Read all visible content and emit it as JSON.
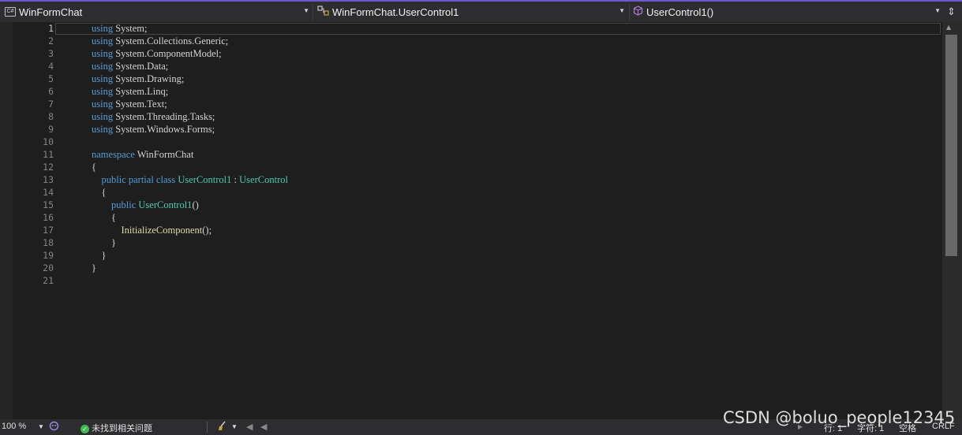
{
  "navbar": {
    "project_label": "WinFormChat",
    "type_label": "WinFormChat.UserControl1",
    "member_label": "UserControl1()"
  },
  "icons": {
    "project": "csharp-project-icon",
    "type": "class-icon",
    "member": "method-cube-icon",
    "split": "split-window-icon"
  },
  "code_lines": [
    {
      "n": "1",
      "tokens": [
        {
          "t": "using",
          "c": "kw"
        },
        {
          "t": " System;",
          "c": "pl"
        }
      ]
    },
    {
      "n": "2",
      "tokens": [
        {
          "t": "using",
          "c": "kw"
        },
        {
          "t": " System.Collections.Generic;",
          "c": "pl"
        }
      ]
    },
    {
      "n": "3",
      "tokens": [
        {
          "t": "using",
          "c": "kw"
        },
        {
          "t": " System.ComponentModel;",
          "c": "pl"
        }
      ]
    },
    {
      "n": "4",
      "tokens": [
        {
          "t": "using",
          "c": "kw"
        },
        {
          "t": " System.Data;",
          "c": "pl"
        }
      ]
    },
    {
      "n": "5",
      "tokens": [
        {
          "t": "using",
          "c": "kw"
        },
        {
          "t": " System.Drawing;",
          "c": "pl"
        }
      ]
    },
    {
      "n": "6",
      "tokens": [
        {
          "t": "using",
          "c": "kw"
        },
        {
          "t": " System.Linq;",
          "c": "pl"
        }
      ]
    },
    {
      "n": "7",
      "tokens": [
        {
          "t": "using",
          "c": "kw"
        },
        {
          "t": " System.Text;",
          "c": "pl"
        }
      ]
    },
    {
      "n": "8",
      "tokens": [
        {
          "t": "using",
          "c": "kw"
        },
        {
          "t": " System.Threading.Tasks;",
          "c": "pl"
        }
      ]
    },
    {
      "n": "9",
      "tokens": [
        {
          "t": "using",
          "c": "kw"
        },
        {
          "t": " System.Windows.Forms;",
          "c": "pl"
        }
      ]
    },
    {
      "n": "10",
      "tokens": []
    },
    {
      "n": "11",
      "tokens": [
        {
          "t": "namespace",
          "c": "kw"
        },
        {
          "t": " WinFormChat",
          "c": "pl"
        }
      ]
    },
    {
      "n": "12",
      "tokens": [
        {
          "t": "{",
          "c": "pl"
        }
      ]
    },
    {
      "n": "13",
      "tokens": [
        {
          "t": "    ",
          "c": "pl"
        },
        {
          "t": "public partial class",
          "c": "kw"
        },
        {
          "t": " ",
          "c": "pl"
        },
        {
          "t": "UserControl1",
          "c": "ty"
        },
        {
          "t": " : ",
          "c": "pl"
        },
        {
          "t": "UserControl",
          "c": "ty"
        }
      ]
    },
    {
      "n": "14",
      "tokens": [
        {
          "t": "    {",
          "c": "pl"
        }
      ]
    },
    {
      "n": "15",
      "tokens": [
        {
          "t": "        ",
          "c": "pl"
        },
        {
          "t": "public",
          "c": "kw"
        },
        {
          "t": " ",
          "c": "pl"
        },
        {
          "t": "UserControl1",
          "c": "ty"
        },
        {
          "t": "()",
          "c": "pl"
        }
      ]
    },
    {
      "n": "16",
      "tokens": [
        {
          "t": "        {",
          "c": "pl"
        }
      ]
    },
    {
      "n": "17",
      "tokens": [
        {
          "t": "            ",
          "c": "pl"
        },
        {
          "t": "InitializeComponent",
          "c": "fn"
        },
        {
          "t": "();",
          "c": "pl"
        }
      ]
    },
    {
      "n": "18",
      "tokens": [
        {
          "t": "        }",
          "c": "pl"
        }
      ]
    },
    {
      "n": "19",
      "tokens": [
        {
          "t": "    }",
          "c": "pl"
        }
      ]
    },
    {
      "n": "20",
      "tokens": [
        {
          "t": "}",
          "c": "pl"
        }
      ]
    },
    {
      "n": "21",
      "tokens": []
    }
  ],
  "status": {
    "zoom": "100 %",
    "issues": "未找到相关问题",
    "line": "行: 1",
    "char": "字符: 1",
    "spaces": "空格",
    "eol": "CRLF"
  },
  "watermark": "CSDN @boluo_people12345",
  "colors": {
    "keyword": "#569cd6",
    "type": "#4ec9b0",
    "method": "#dcdcaa",
    "text": "#d4d4d4",
    "line_number": "#858585",
    "background": "#1e1e1e"
  }
}
